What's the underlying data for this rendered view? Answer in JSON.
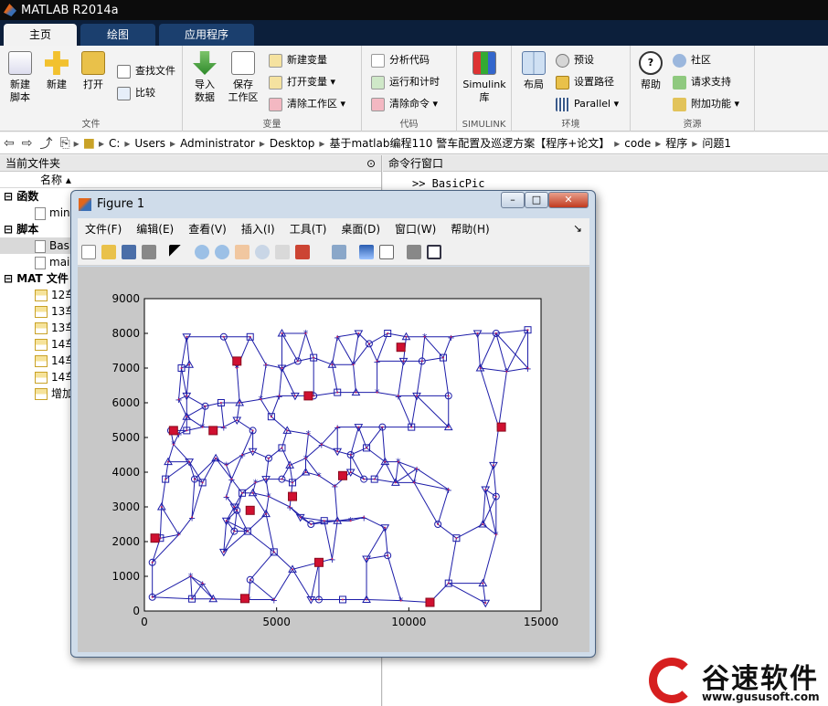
{
  "app": {
    "title": "MATLAB R2014a"
  },
  "tabs": [
    {
      "label": "主页"
    },
    {
      "label": "绘图"
    },
    {
      "label": "应用程序"
    }
  ],
  "ribbon": {
    "file": {
      "label": "文件",
      "new_script": "新建\n脚本",
      "new": "新建",
      "open": "打开",
      "find_files": "查找文件",
      "compare": "比较"
    },
    "variable": {
      "label": "变量",
      "import": "导入\n数据",
      "save_ws": "保存\n工作区",
      "new_var": "新建变量",
      "open_var": "打开变量",
      "clear_ws": "清除工作区"
    },
    "code": {
      "label": "代码",
      "analyze": "分析代码",
      "run_time": "运行和计时",
      "clear_cmd": "清除命令"
    },
    "simulink": {
      "label": "SIMULINK",
      "lib": "Simulink\n库"
    },
    "env": {
      "label": "环境",
      "layout": "布局",
      "prefs": "预设",
      "set_path": "设置路径",
      "parallel": "Parallel"
    },
    "resources": {
      "label": "资源",
      "help": "帮助",
      "community": "社区",
      "request": "请求支持",
      "addons": "附加功能"
    }
  },
  "address": {
    "parts": [
      "C:",
      "Users",
      "Administrator",
      "Desktop",
      "基于matlab编程110 警车配置及巡逻方案【程序+论文】",
      "code",
      "程序",
      "问题1"
    ]
  },
  "left_pane": {
    "title": "当前文件夹",
    "col_name": "名称",
    "sections": [
      {
        "label": "函数",
        "items": [
          "min"
        ]
      },
      {
        "label": "脚本",
        "items": [
          "Basi",
          "mai"
        ]
      },
      {
        "label": "MAT 文件",
        "items": [
          "12车",
          "13车",
          "13车",
          "14车",
          "14车",
          "14车",
          "增加"
        ]
      }
    ]
  },
  "command_window": {
    "title": "命令行窗口",
    "prompt_text": ">> BasicPic"
  },
  "figure": {
    "title": "Figure 1",
    "menu": [
      "文件(F)",
      "编辑(E)",
      "查看(V)",
      "插入(I)",
      "工具(T)",
      "桌面(D)",
      "窗口(W)",
      "帮助(H)"
    ],
    "window_buttons": {
      "minimize": "–",
      "maximize": "□",
      "close": "✕"
    }
  },
  "chart_data": {
    "type": "scatter",
    "xlim": [
      0,
      15000
    ],
    "ylim": [
      0,
      9000
    ],
    "xticks": [
      0,
      5000,
      10000,
      15000
    ],
    "yticks": [
      0,
      1000,
      2000,
      3000,
      4000,
      5000,
      6000,
      7000,
      8000,
      9000
    ],
    "grid": false,
    "colors": {
      "line": "#1c1ca8",
      "marker": "#c0185a",
      "highlight": "#d01030"
    },
    "nodes": [
      [
        300,
        400
      ],
      [
        1800,
        350
      ],
      [
        2600,
        350
      ],
      [
        3950,
        330
      ],
      [
        4900,
        330
      ],
      [
        6300,
        330
      ],
      [
        6600,
        330
      ],
      [
        7500,
        330
      ],
      [
        8400,
        330
      ],
      [
        9700,
        300
      ],
      [
        10800,
        250
      ],
      [
        12900,
        230
      ],
      [
        300,
        1400
      ],
      [
        600,
        2100
      ],
      [
        650,
        3000
      ],
      [
        1750,
        1000
      ],
      [
        2200,
        800
      ],
      [
        3000,
        1700
      ],
      [
        4000,
        900
      ],
      [
        4900,
        1700
      ],
      [
        5600,
        1200
      ],
      [
        6600,
        1400
      ],
      [
        7100,
        1500
      ],
      [
        8400,
        1500
      ],
      [
        9200,
        1600
      ],
      [
        11500,
        800
      ],
      [
        12800,
        800
      ],
      [
        1300,
        2200
      ],
      [
        1800,
        2700
      ],
      [
        3100,
        2600
      ],
      [
        3500,
        2900
      ],
      [
        3700,
        3400
      ],
      [
        4100,
        3400
      ],
      [
        4700,
        3300
      ],
      [
        5500,
        3000
      ],
      [
        5900,
        2700
      ],
      [
        6300,
        2500
      ],
      [
        6800,
        2600
      ],
      [
        7300,
        2600
      ],
      [
        7800,
        2600
      ],
      [
        8300,
        2700
      ],
      [
        9100,
        2400
      ],
      [
        11100,
        2500
      ],
      [
        11800,
        2100
      ],
      [
        12800,
        2500
      ],
      [
        13300,
        2200
      ],
      [
        3100,
        3300
      ],
      [
        3400,
        3000
      ],
      [
        3400,
        2300
      ],
      [
        3900,
        2300
      ],
      [
        4600,
        2800
      ],
      [
        4200,
        3700
      ],
      [
        3300,
        3800
      ],
      [
        4600,
        3800
      ],
      [
        5200,
        3800
      ],
      [
        5600,
        3700
      ],
      [
        6100,
        4000
      ],
      [
        6600,
        3900
      ],
      [
        7200,
        3600
      ],
      [
        7800,
        4000
      ],
      [
        8300,
        3800
      ],
      [
        8700,
        3800
      ],
      [
        9500,
        3700
      ],
      [
        10200,
        3700
      ],
      [
        11500,
        3500
      ],
      [
        12900,
        3500
      ],
      [
        13300,
        3300
      ],
      [
        800,
        3800
      ],
      [
        900,
        4300
      ],
      [
        1100,
        4800
      ],
      [
        1300,
        5100
      ],
      [
        1700,
        4300
      ],
      [
        1900,
        3800
      ],
      [
        2200,
        3700
      ],
      [
        2700,
        4400
      ],
      [
        3100,
        4200
      ],
      [
        3700,
        4500
      ],
      [
        4100,
        4600
      ],
      [
        4700,
        4400
      ],
      [
        5200,
        4700
      ],
      [
        5500,
        4200
      ],
      [
        6100,
        4400
      ],
      [
        6700,
        4800
      ],
      [
        7300,
        4600
      ],
      [
        7800,
        4500
      ],
      [
        8400,
        4700
      ],
      [
        9100,
        4300
      ],
      [
        9600,
        4300
      ],
      [
        10300,
        4100
      ],
      [
        13200,
        4200
      ],
      [
        1000,
        5200
      ],
      [
        1600,
        5200
      ],
      [
        1600,
        5600
      ],
      [
        2200,
        5300
      ],
      [
        3000,
        5300
      ],
      [
        3500,
        5500
      ],
      [
        4100,
        5200
      ],
      [
        4800,
        5600
      ],
      [
        5400,
        5200
      ],
      [
        6200,
        5100
      ],
      [
        7300,
        5300
      ],
      [
        8100,
        5300
      ],
      [
        9000,
        5300
      ],
      [
        10100,
        5300
      ],
      [
        11500,
        5300
      ],
      [
        13400,
        5300
      ],
      [
        1300,
        6100
      ],
      [
        1600,
        6200
      ],
      [
        2300,
        5900
      ],
      [
        2900,
        6000
      ],
      [
        3600,
        6000
      ],
      [
        4400,
        6100
      ],
      [
        5100,
        6200
      ],
      [
        5700,
        6200
      ],
      [
        6400,
        6200
      ],
      [
        7300,
        6300
      ],
      [
        8000,
        6300
      ],
      [
        8800,
        6300
      ],
      [
        9600,
        6200
      ],
      [
        10300,
        6200
      ],
      [
        11500,
        6200
      ],
      [
        1400,
        7000
      ],
      [
        1700,
        7100
      ],
      [
        3500,
        7000
      ],
      [
        4600,
        7100
      ],
      [
        5200,
        7000
      ],
      [
        5800,
        7200
      ],
      [
        6400,
        7300
      ],
      [
        7100,
        7100
      ],
      [
        7900,
        7100
      ],
      [
        8800,
        7200
      ],
      [
        9800,
        7200
      ],
      [
        10500,
        7200
      ],
      [
        11300,
        7300
      ],
      [
        12700,
        7000
      ],
      [
        13700,
        6900
      ],
      [
        14500,
        7000
      ],
      [
        1600,
        7900
      ],
      [
        3000,
        7900
      ],
      [
        4000,
        7900
      ],
      [
        5200,
        8000
      ],
      [
        6100,
        8000
      ],
      [
        7300,
        7900
      ],
      [
        8100,
        8000
      ],
      [
        8500,
        7700
      ],
      [
        9200,
        8000
      ],
      [
        9900,
        7900
      ],
      [
        10600,
        7900
      ],
      [
        11600,
        7900
      ],
      [
        12600,
        8000
      ],
      [
        13300,
        8000
      ],
      [
        14500,
        8100
      ]
    ],
    "highlighted": [
      [
        400,
        2100
      ],
      [
        1100,
        5200
      ],
      [
        2600,
        5200
      ],
      [
        3500,
        7200
      ],
      [
        6200,
        6200
      ],
      [
        4000,
        2900
      ],
      [
        5600,
        3300
      ],
      [
        7500,
        3900
      ],
      [
        6600,
        1400
      ],
      [
        9700,
        7600
      ],
      [
        13500,
        5300
      ],
      [
        10800,
        250
      ],
      [
        3800,
        360
      ]
    ]
  }
}
